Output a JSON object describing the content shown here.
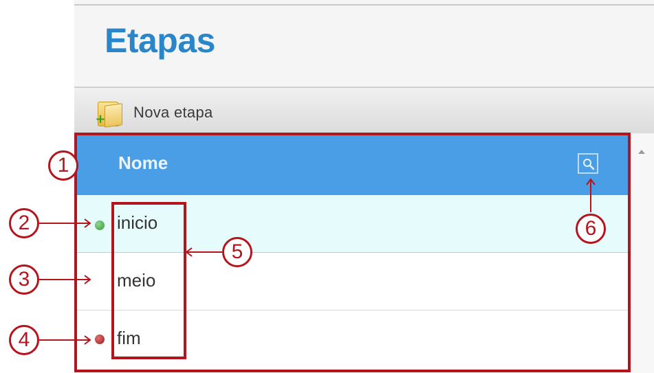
{
  "header": {
    "title": "Etapas"
  },
  "toolbar": {
    "new_stage_label": "Nova etapa",
    "new_stage_icon": "folder-add-icon"
  },
  "grid": {
    "column_header": "Nome",
    "search_icon": "search-icon",
    "rows": [
      {
        "label": "inicio",
        "marker": "green-dot",
        "selected": true
      },
      {
        "label": "meio",
        "marker": null,
        "selected": false
      },
      {
        "label": "fim",
        "marker": "red-dot",
        "selected": false
      }
    ]
  },
  "annotations": {
    "callouts": [
      "1",
      "2",
      "3",
      "4",
      "5",
      "6"
    ],
    "color": "#b4141c"
  },
  "colors": {
    "title": "#2a86c8",
    "header_bg": "#4a9ee6",
    "selected_row_bg": "#e6fbfb",
    "start_marker": "#3a9a3a",
    "end_marker": "#9a1a1a"
  }
}
